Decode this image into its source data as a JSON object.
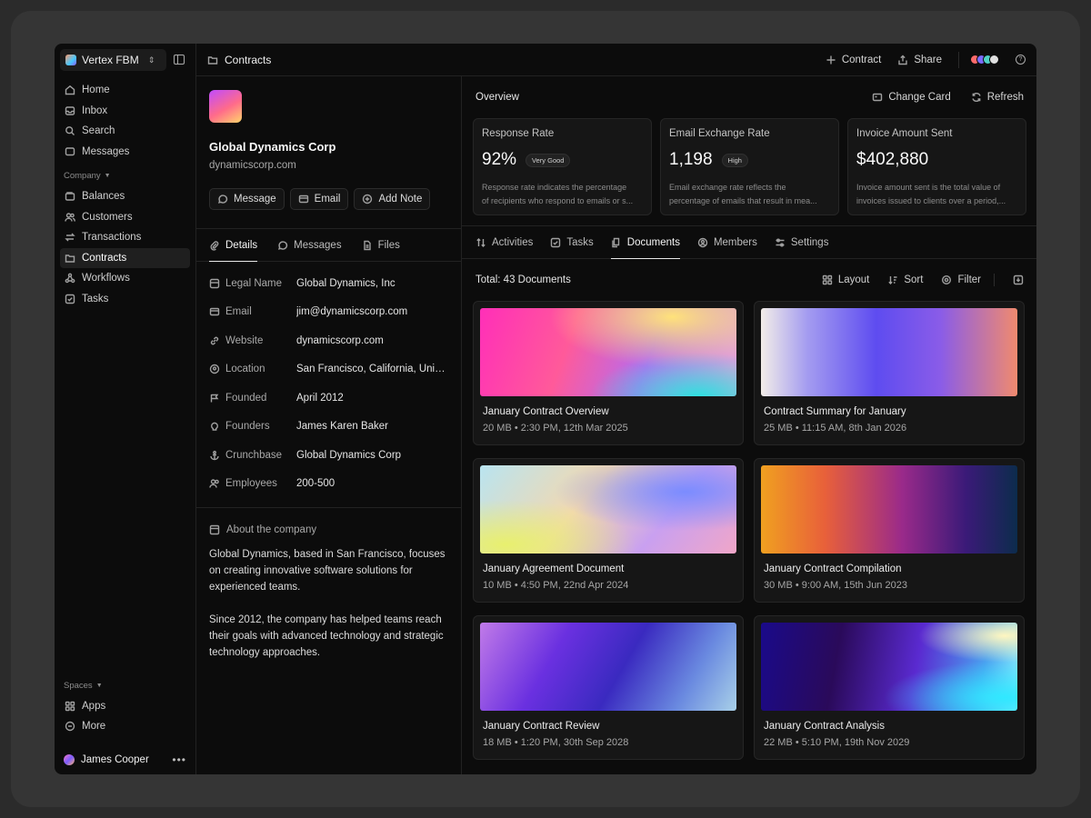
{
  "workspace": {
    "name": "Vertex FBM"
  },
  "sidebar": {
    "main_items": [
      {
        "label": "Home",
        "icon": "home-icon"
      },
      {
        "label": "Inbox",
        "icon": "inbox-icon"
      },
      {
        "label": "Search",
        "icon": "search-icon"
      },
      {
        "label": "Messages",
        "icon": "message-icon"
      }
    ],
    "company_label": "Company",
    "company_items": [
      {
        "label": "Balances",
        "icon": "wallet-icon"
      },
      {
        "label": "Customers",
        "icon": "users-icon"
      },
      {
        "label": "Transactions",
        "icon": "transfer-icon"
      },
      {
        "label": "Contracts",
        "icon": "folder-icon",
        "active": true
      },
      {
        "label": "Workflows",
        "icon": "workflow-icon"
      },
      {
        "label": "Tasks",
        "icon": "checkbox-icon"
      }
    ],
    "spaces_label": "Spaces",
    "space_items": [
      {
        "label": "Apps",
        "icon": "grid-icon"
      },
      {
        "label": "More",
        "icon": "more-circle-icon"
      }
    ],
    "user": {
      "name": "James Cooper"
    }
  },
  "topbar": {
    "title": "Contracts",
    "new_contract": "Contract",
    "share": "Share"
  },
  "company": {
    "name": "Global Dynamics Corp",
    "domain": "dynamicscorp.com",
    "actions": {
      "message": "Message",
      "email": "Email",
      "add_note": "Add Note"
    },
    "tabs": {
      "details": "Details",
      "messages": "Messages",
      "files": "Files"
    },
    "details": [
      {
        "label": "Legal Name",
        "value": "Global Dynamics, Inc"
      },
      {
        "label": "Email",
        "value": "jim@dynamicscorp.com"
      },
      {
        "label": "Website",
        "value": "dynamicscorp.com"
      },
      {
        "label": "Location",
        "value": "San Francisco, California, United States"
      },
      {
        "label": "Founded",
        "value": "April 2012"
      },
      {
        "label": "Founders",
        "value": "James Karen Baker"
      },
      {
        "label": "Crunchbase",
        "value": "Global Dynamics Corp"
      },
      {
        "label": "Employees",
        "value": "200-500"
      }
    ],
    "about_title": "About the company",
    "about_p1": "Global Dynamics, based in San Francisco, focuses on creating innovative software solutions for experienced teams.",
    "about_p2": "Since 2012, the company has helped teams reach their goals with advanced technology and strategic technology approaches."
  },
  "overview": {
    "title": "Overview",
    "change_card": "Change Card",
    "refresh": "Refresh",
    "stats": [
      {
        "label": "Response Rate",
        "value": "92%",
        "badge": "Very Good",
        "desc1": "Response rate indicates the percentage",
        "desc2": "of recipients who respond to emails or s..."
      },
      {
        "label": "Email Exchange Rate",
        "value": "1,198",
        "badge": "High",
        "desc1": "Email exchange rate reflects the",
        "desc2": "percentage of emails that result in mea..."
      },
      {
        "label": "Invoice Amount Sent",
        "value": "$402,880",
        "badge": "",
        "desc1": "Invoice amount sent is the total value of",
        "desc2": "invoices issued to clients over a period,..."
      }
    ]
  },
  "right_tabs": {
    "activities": "Activities",
    "tasks": "Tasks",
    "documents": "Documents",
    "members": "Members",
    "settings": "Settings"
  },
  "documents": {
    "total": "Total: 43 Documents",
    "layout": "Layout",
    "sort": "Sort",
    "filter": "Filter",
    "items": [
      {
        "title": "January Contract Overview",
        "meta": "20 MB • 2:30 PM, 12th Mar 2025"
      },
      {
        "title": "Contract Summary for January",
        "meta": "25 MB • 11:15 AM, 8th Jan 2026"
      },
      {
        "title": "January Agreement Document",
        "meta": "10 MB • 4:50 PM, 22nd Apr 2024"
      },
      {
        "title": "January Contract Compilation",
        "meta": "30 MB • 9:00 AM, 15th Jun 2023"
      },
      {
        "title": "January Contract Review",
        "meta": "18 MB • 1:20 PM, 30th Sep 2028"
      },
      {
        "title": "January Contract Analysis",
        "meta": "22 MB • 5:10 PM, 19th Nov 2029"
      }
    ]
  },
  "colors": {
    "background": "#0c0c0c",
    "card": "#161616",
    "border": "#262626",
    "text": "#e8e8e8"
  }
}
